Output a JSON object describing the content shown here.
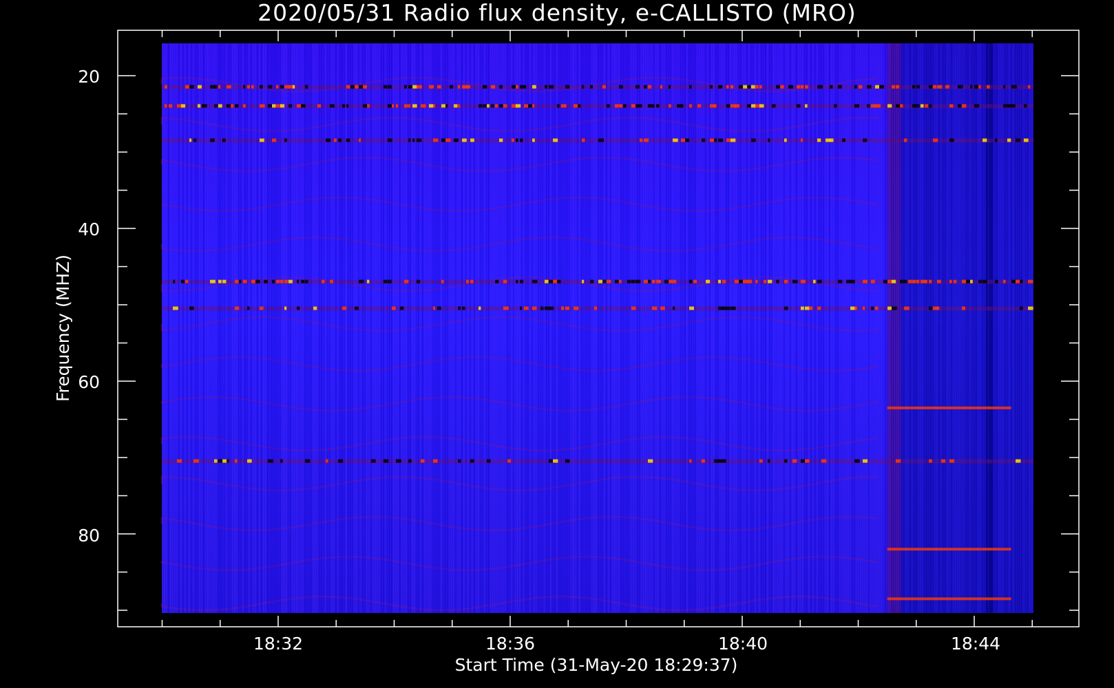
{
  "chart_data": {
    "type": "heatmap",
    "title": "2020/05/31  Radio flux density, e-CALLISTO (MRO)",
    "xlabel": "Start Time (31-May-20 18:29:37)",
    "ylabel": "Frequency (MHZ)",
    "x_ticks": [
      "18:32",
      "18:36",
      "18:40",
      "18:44"
    ],
    "y_ticks": [
      "20",
      "40",
      "60",
      "80"
    ],
    "x_range": [
      "18:29:37",
      "18:44:37"
    ],
    "y_range_mhz": [
      16,
      90
    ],
    "y_inverted": true,
    "colormap": "blue-red (rainbow)",
    "features": [
      {
        "description": "horizontal interference bands",
        "frequencies_mhz": [
          21.5,
          24,
          28.5,
          47,
          50.5,
          70.5
        ]
      },
      {
        "description": "change in background level from ~18:42:30 onward",
        "time": "18:42:30"
      }
    ]
  },
  "colors": {
    "background": "#000000",
    "axes": "#ffffff",
    "low": "#0000d0",
    "mid": "#3a14ff",
    "high": "#ff3a00",
    "peak": "#ffe000"
  }
}
